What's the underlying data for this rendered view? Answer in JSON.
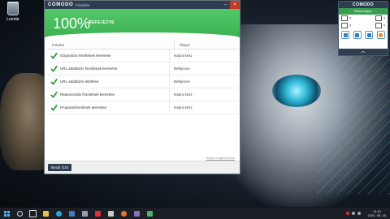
{
  "desktop": {
    "recycle_bin_label": "Lomtár"
  },
  "window": {
    "brand": "COMODO",
    "subtitle": "Frissítés",
    "minimize_glyph": "–",
    "close_glyph": "×",
    "banner": {
      "percent": "100%",
      "status": "BEFEJEZVE",
      "color": "#3cb152",
      "progress": 1.0
    },
    "table": {
      "headers": [
        "Feladat",
        "Állapot"
      ],
      "rows": [
        {
          "task": "Szignatúra frissítések keresése",
          "status": "Napra kész"
        },
        {
          "task": "URL adatbázis frissítések keresése",
          "status": "Befejezve"
        },
        {
          "task": "URL adatbázis letöltése",
          "status": "Befejezve"
        },
        {
          "task": "Reasonnolity frissítések keresése",
          "status": "Napra kész"
        },
        {
          "task": "Programfrissítések keresése",
          "status": "Napra kész"
        }
      ]
    },
    "details_link": "Napló megtekintése",
    "close_button": "Bezár (10)"
  },
  "widget": {
    "title": "COMODO",
    "subtitle": "Biztonságos",
    "row1_left": "0",
    "row1_right": "3",
    "row2_left": "0",
    "row2_right": "0",
    "up_glyph": "︿"
  },
  "taskbar": {
    "time": "11:01",
    "date": "2021. 05. 15."
  }
}
